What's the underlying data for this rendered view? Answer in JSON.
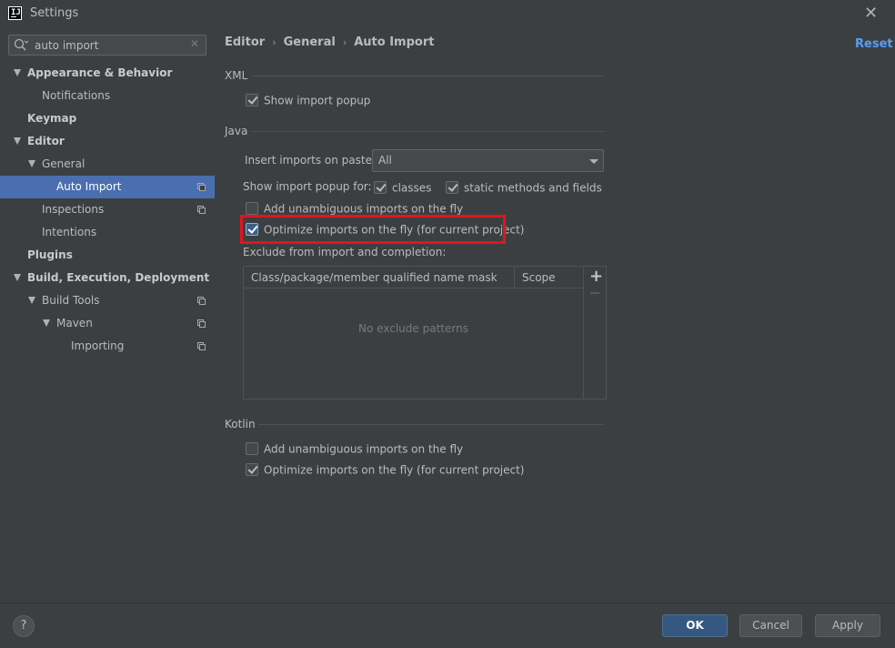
{
  "window": {
    "title": "Settings",
    "app_icon_text": "IJ"
  },
  "search": {
    "value": "auto import"
  },
  "sidebar": {
    "items": [
      {
        "label": "Appearance & Behavior",
        "level": 0,
        "expanded": true,
        "bold": true
      },
      {
        "label": "Notifications",
        "level": 1
      },
      {
        "label": "Keymap",
        "level": 0,
        "bold": true
      },
      {
        "label": "Editor",
        "level": 0,
        "expanded": true,
        "bold": true
      },
      {
        "label": "General",
        "level": 1,
        "expanded": true
      },
      {
        "label": "Auto Import",
        "level": 2,
        "selected": true,
        "project_icon": true
      },
      {
        "label": "Inspections",
        "level": 1,
        "project_icon": true
      },
      {
        "label": "Intentions",
        "level": 1
      },
      {
        "label": "Plugins",
        "level": 0,
        "bold": true
      },
      {
        "label": "Build, Execution, Deployment",
        "level": 0,
        "expanded": true,
        "bold": true
      },
      {
        "label": "Build Tools",
        "level": 1,
        "expanded": true,
        "project_icon": true
      },
      {
        "label": "Maven",
        "level": 2,
        "expanded": true,
        "project_icon": true
      },
      {
        "label": "Importing",
        "level": 3,
        "project_icon": true
      }
    ]
  },
  "breadcrumb": {
    "items": [
      "Editor",
      "General",
      "Auto Import"
    ],
    "separator": "›"
  },
  "reset_label": "Reset",
  "xml": {
    "title": "XML",
    "show_import_popup": {
      "label": "Show import popup",
      "checked": true
    }
  },
  "java": {
    "title": "Java",
    "insert_imports_label": "Insert imports on paste:",
    "insert_imports_value": "All",
    "show_popup_for_label": "Show import popup for:",
    "classes": {
      "label": "classes",
      "checked": true
    },
    "static_methods": {
      "label": "static methods and fields",
      "checked": true
    },
    "add_unambiguous": {
      "label": "Add unambiguous imports on the fly",
      "checked": false
    },
    "optimize_imports": {
      "label": "Optimize imports on the fly (for current project)",
      "checked": true,
      "highlighted": true
    },
    "exclude_label": "Exclude from import and completion:",
    "table": {
      "columns": [
        "Class/package/member qualified name mask",
        "Scope"
      ],
      "empty_text": "No exclude patterns",
      "add_label": "+"
    }
  },
  "kotlin": {
    "title": "Kotlin",
    "add_unambiguous": {
      "label": "Add unambiguous imports on the fly",
      "checked": false
    },
    "optimize_imports": {
      "label": "Optimize imports on the fly (for current project)",
      "checked": true
    }
  },
  "footer": {
    "help_label": "?",
    "ok_label": "OK",
    "cancel_label": "Cancel",
    "apply_label": "Apply"
  },
  "colors": {
    "background": "#3c3f41",
    "selection": "#4b6eaf",
    "link": "#589df6",
    "highlight_border": "#e5131d",
    "primary_button": "#365880"
  }
}
